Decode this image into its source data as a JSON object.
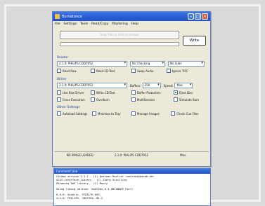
{
  "window": {
    "title": "Burnatonce",
    "minimize_glyph": "–",
    "maximize_glyph": "□",
    "close_glyph": "×"
  },
  "menu": [
    "File",
    "Settings",
    "Tools",
    "Read/Copy",
    "Mastering",
    "Help"
  ],
  "source": {
    "drop_hint": "Drop files or click to browse",
    "progress_percent": 0
  },
  "write_button": "Write",
  "reader": {
    "group_label": "Reader",
    "drive": "2.1.0: PHILIPS  CDD7952",
    "checking": "No Checking",
    "subs": "No Subs",
    "options": [
      {
        "label": "Read Raw",
        "checked": false
      },
      {
        "label": "Read CD-Text",
        "checked": false
      },
      {
        "label": "Swap Audio",
        "checked": false
      },
      {
        "label": "Ignore TOC",
        "checked": false
      }
    ]
  },
  "writer": {
    "group_label": "Writer",
    "drive": "2.1.0: PHILIPS  CDD7952",
    "buffers_label": "Buffers:",
    "buffers_value": "256",
    "speed_label": "Speed:",
    "speed_value": "Max",
    "options_row1": [
      {
        "label": "Use Raw Driver",
        "checked": false
      },
      {
        "label": "Write CD-Text",
        "checked": false
      },
      {
        "label": "Buffer Protection",
        "checked": false
      },
      {
        "label": "Eject Disc",
        "checked": true
      }
    ],
    "options_row2": [
      {
        "label": "Force Execution",
        "checked": false
      },
      {
        "label": "Overburn",
        "checked": false
      },
      {
        "label": "MultiSession",
        "checked": false
      },
      {
        "label": "Simulate Burn",
        "checked": false
      }
    ]
  },
  "other": {
    "group_label": "Other Settings",
    "options": [
      {
        "label": "Autoload Settings",
        "checked": false
      },
      {
        "label": "Minimize to Tray",
        "checked": false
      },
      {
        "label": "Manage Images",
        "checked": false
      },
      {
        "label": "Check Cue Files",
        "checked": false
      }
    ]
  },
  "status": {
    "image": "NO IMAGE LOADED",
    "drive": "2.1.0: PHILIPS  CDD7952",
    "speed": "Max"
  },
  "console": {
    "title": "Command Line",
    "lines": [
      "Cdrdao version 1.1.7 - (C) Andreas Mueller <andreas@daneb.de>",
      "  SCSI interface library - (C) Joerg Schilling",
      "  Paranoia DAE library - (C) Monty",
      "Using libscg version 'andreas-0.5-UNIXWARE_Port'",
      "0,0,0: Generic, STEALTH DVD,",
      "2,1,0: PHILIPS, CDD7952, B1.2"
    ]
  }
}
